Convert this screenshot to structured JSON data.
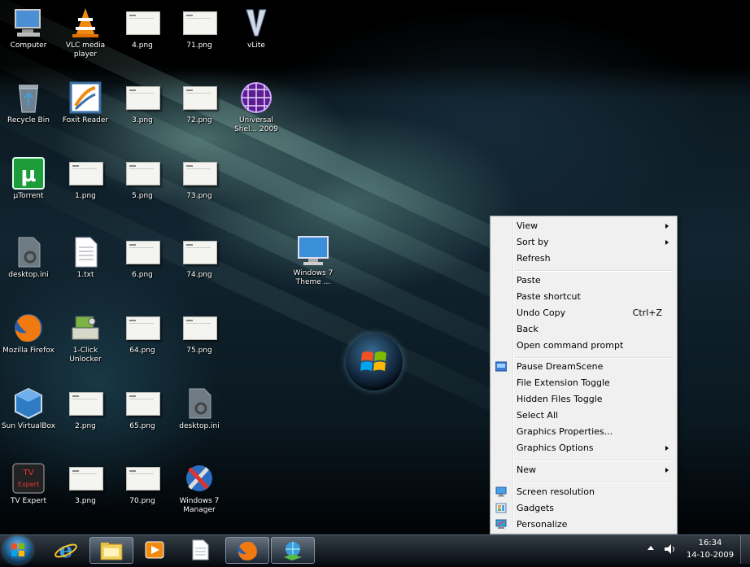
{
  "desktop_icons": [
    {
      "label": "Computer",
      "icon": "computer-icon"
    },
    {
      "label": "VLC media player",
      "icon": "vlc-cone-icon"
    },
    {
      "label": "4.png",
      "icon": "image-file-icon"
    },
    {
      "label": "71.png",
      "icon": "image-file-icon"
    },
    {
      "label": "vLite",
      "icon": "vlite-icon"
    },
    {
      "label": "Recycle Bin",
      "icon": "recycle-bin-icon"
    },
    {
      "label": "Foxit Reader",
      "icon": "foxit-reader-icon"
    },
    {
      "label": "3.png",
      "icon": "image-file-icon"
    },
    {
      "label": "72.png",
      "icon": "image-file-icon"
    },
    {
      "label": "Universal Shel... 2009",
      "icon": "globe-grid-icon"
    },
    {
      "label": "µTorrent",
      "icon": "utorrent-icon"
    },
    {
      "label": "1.png",
      "icon": "image-file-icon"
    },
    {
      "label": "5.png",
      "icon": "image-file-icon"
    },
    {
      "label": "73.png",
      "icon": "image-file-icon"
    },
    {
      "label": "desktop.ini",
      "icon": "settings-file-icon"
    },
    {
      "label": "1.txt",
      "icon": "text-file-icon"
    },
    {
      "label": "6.png",
      "icon": "image-file-icon"
    },
    {
      "label": "74.png",
      "icon": "image-file-icon"
    },
    {
      "label": "Mozilla Firefox",
      "icon": "firefox-icon"
    },
    {
      "label": "1-Click Unlocker",
      "icon": "unlocker-icon"
    },
    {
      "label": "64.png",
      "icon": "image-file-icon"
    },
    {
      "label": "75.png",
      "icon": "image-file-icon"
    },
    {
      "label": "Sun VirtualBox",
      "icon": "virtualbox-icon"
    },
    {
      "label": "2.png",
      "icon": "image-file-icon"
    },
    {
      "label": "65.png",
      "icon": "image-file-icon"
    },
    {
      "label": "desktop.ini",
      "icon": "settings-file-icon"
    },
    {
      "label": "TV Expert",
      "icon": "tv-expert-icon"
    },
    {
      "label": "3.png",
      "icon": "image-file-icon"
    },
    {
      "label": "70.png",
      "icon": "image-file-icon"
    },
    {
      "label": "Windows 7 Manager",
      "icon": "tools-icon"
    },
    {
      "label": "Windows 7 Theme ...",
      "icon": "monitor-icon"
    }
  ],
  "context_menu": {
    "items": [
      {
        "label": "View",
        "submenu": true
      },
      {
        "label": "Sort by",
        "submenu": true
      },
      {
        "label": "Refresh"
      },
      {
        "label": "Paste"
      },
      {
        "label": "Paste shortcut"
      },
      {
        "label": "Undo Copy",
        "shortcut": "Ctrl+Z"
      },
      {
        "label": "Back"
      },
      {
        "label": "Open command prompt"
      },
      {
        "label": "Pause DreamScene",
        "icon": "dreamscene-icon"
      },
      {
        "label": "File Extension Toggle"
      },
      {
        "label": "Hidden Files Toggle"
      },
      {
        "label": "Select All"
      },
      {
        "label": "Graphics Properties..."
      },
      {
        "label": "Graphics Options",
        "submenu": true
      },
      {
        "label": "New",
        "submenu": true
      },
      {
        "label": "Screen resolution",
        "icon": "screen-resolution-icon"
      },
      {
        "label": "Gadgets",
        "icon": "gadgets-icon"
      },
      {
        "label": "Personalize",
        "icon": "personalize-icon"
      }
    ]
  },
  "taskbar": {
    "buttons": [
      {
        "name": "internet-explorer-icon"
      },
      {
        "name": "folder-icon"
      },
      {
        "name": "media-player-icon"
      },
      {
        "name": "document-icon"
      },
      {
        "name": "firefox-icon"
      },
      {
        "name": "network-download-icon"
      }
    ],
    "clock_time": "16:34",
    "clock_date": "14-10-2009"
  },
  "colors": {
    "menu_bg": "#f0f0f0",
    "taskbar": "#1b252e"
  }
}
